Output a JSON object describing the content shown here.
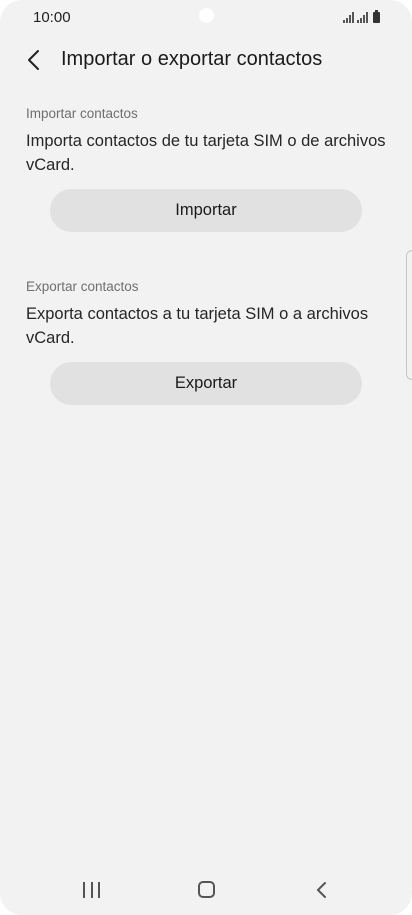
{
  "status_bar": {
    "time": "10:00"
  },
  "header": {
    "title": "Importar o exportar contactos",
    "back_icon": "chevron-left-icon"
  },
  "import_section": {
    "label": "Importar contactos",
    "description": "Importa contactos de tu tarjeta SIM o de archivos vCard.",
    "button_label": "Importar"
  },
  "export_section": {
    "label": "Exportar contactos",
    "description": "Exporta contactos a tu tarjeta SIM o a archivos vCard.",
    "button_label": "Exportar"
  },
  "nav_bar": {
    "recents_icon": "recents-icon",
    "home_icon": "home-icon",
    "back_icon": "back-icon"
  },
  "colors": {
    "background": "#f2f2f2",
    "button_background": "#e1e1e1",
    "section_label": "#6f6f6f",
    "text": "#1a1a1a"
  }
}
